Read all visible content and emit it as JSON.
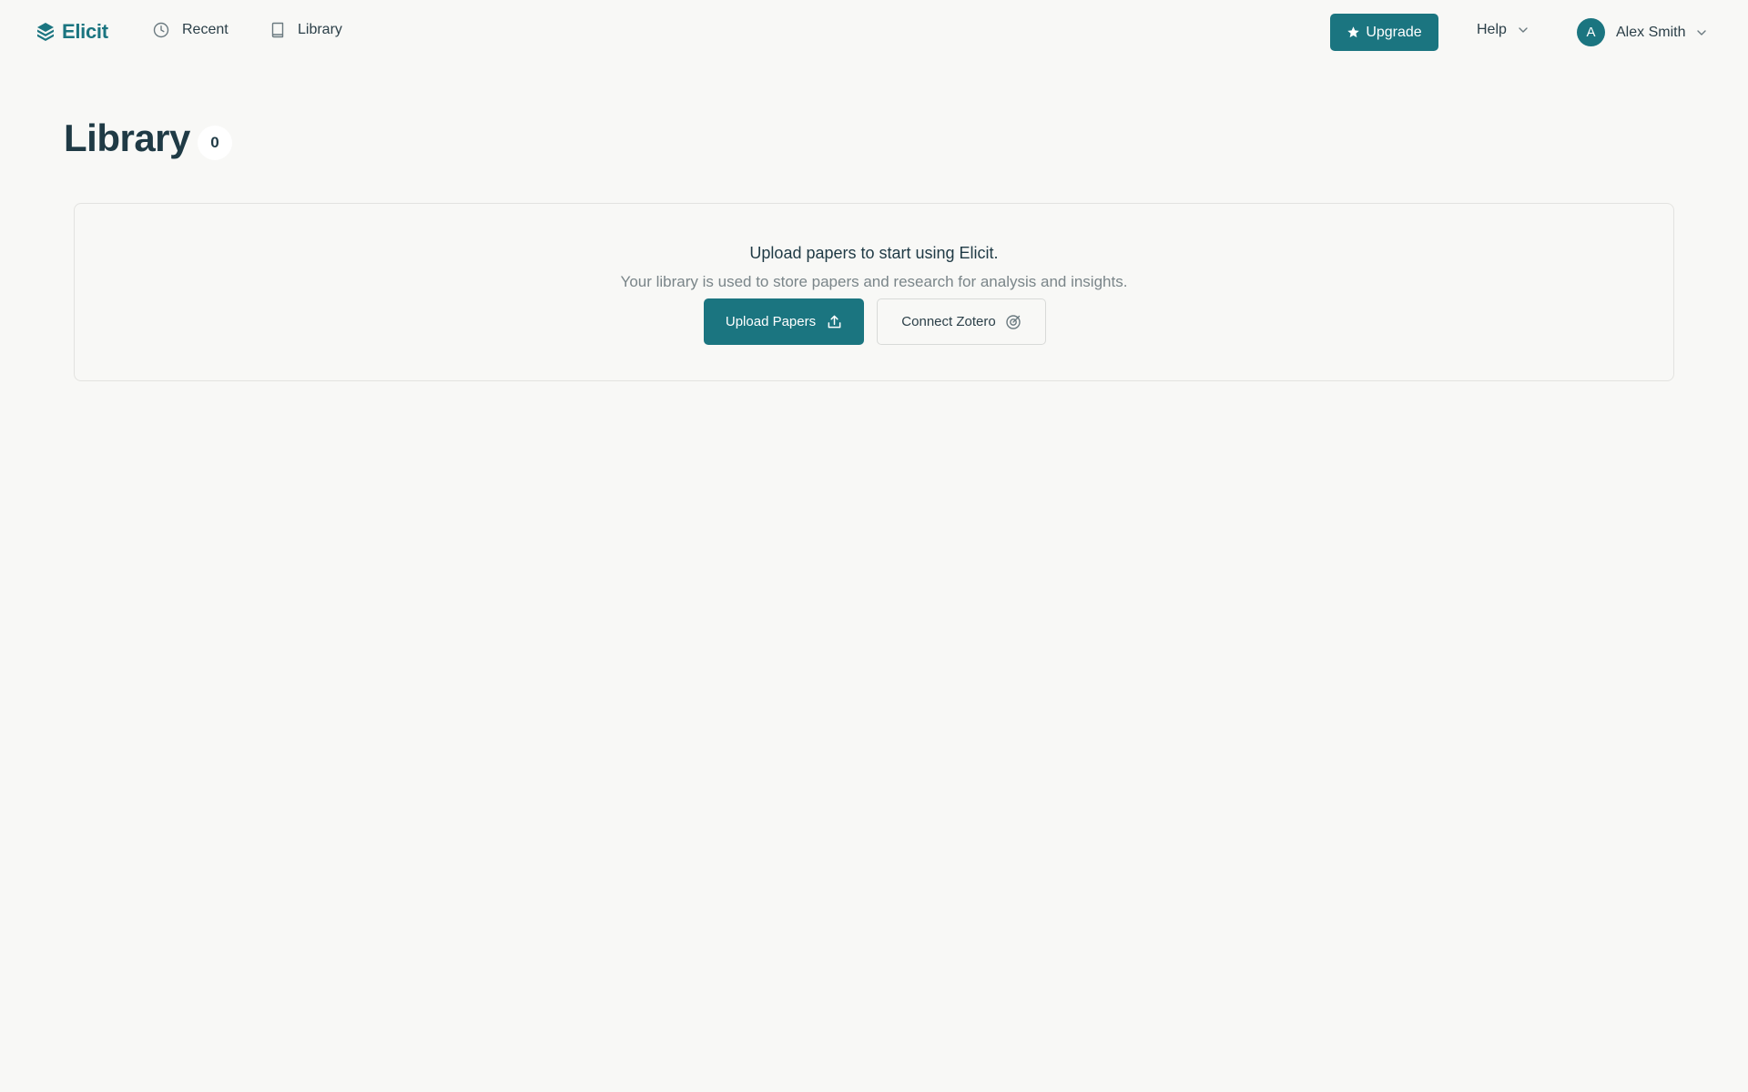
{
  "app": {
    "name": "Elicit",
    "brand_color": "#1b7580"
  },
  "nav": {
    "recent": {
      "label": "Recent",
      "icon": "clock-icon"
    },
    "library": {
      "label": "Library",
      "icon": "book-icon"
    }
  },
  "header": {
    "upgrade_label": "Upgrade",
    "upgrade_icon": "star-icon",
    "help_label": "Help",
    "user": {
      "name": "Alex Smith",
      "initial": "A"
    }
  },
  "main": {
    "title": "Library",
    "count": "0",
    "empty_state": {
      "title": "Upload papers to start using Elicit.",
      "subtitle": "Your library is used to store papers and research for analysis and insights.",
      "upload_label": "Upload Papers",
      "upload_icon": "upload-icon",
      "zotero_label": "Connect Zotero",
      "zotero_icon": "zotero-icon"
    }
  }
}
